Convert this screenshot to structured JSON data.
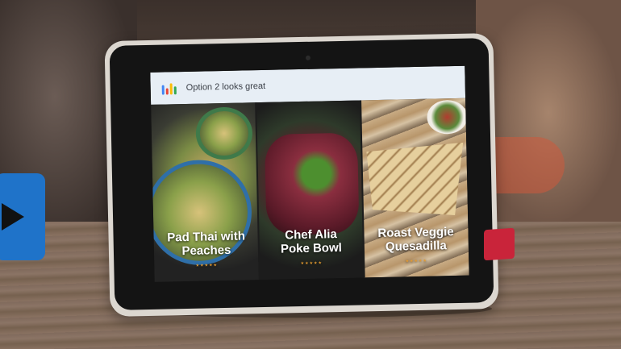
{
  "header": {
    "text": "Option 2 looks great",
    "assistant_logo_colors": [
      "#4285F4",
      "#EA4335",
      "#FBBC05",
      "#34A853"
    ]
  },
  "cards": [
    {
      "title_lines": [
        "Pad Thai with",
        "Peaches"
      ]
    },
    {
      "title_lines": [
        "Chef Alia",
        "Poke Bowl"
      ]
    },
    {
      "title_lines": [
        "Roast Veggie",
        "Quesadilla"
      ]
    }
  ],
  "colors": {
    "device_frame": "#dcd7d0",
    "screen_header": "#e7eef5",
    "blue_object": "#1f73c9",
    "red_tag": "#c9243a"
  }
}
